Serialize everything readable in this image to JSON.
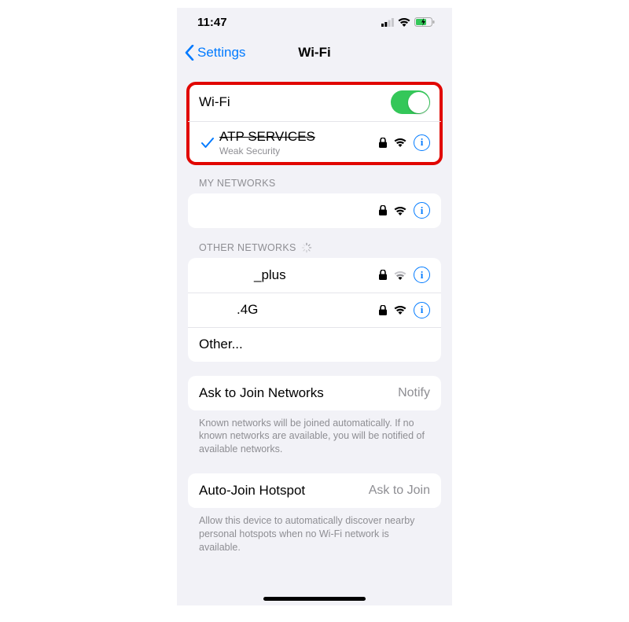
{
  "statusBar": {
    "time": "11:47"
  },
  "nav": {
    "backLabel": "Settings",
    "title": "Wi-Fi"
  },
  "wifi": {
    "toggleLabel": "Wi-Fi",
    "toggleOn": true,
    "connected": {
      "name": "ATP SERVICES",
      "subtitle": "Weak Security",
      "struck": true
    }
  },
  "myNetworks": {
    "header": "MY NETWORKS",
    "items": [
      {
        "name": ""
      }
    ]
  },
  "otherNetworks": {
    "header": "OTHER NETWORKS",
    "items": [
      {
        "name": "_plus"
      },
      {
        "name": ".4G"
      }
    ],
    "otherLabel": "Other..."
  },
  "askToJoin": {
    "title": "Ask to Join Networks",
    "value": "Notify",
    "footer": "Known networks will be joined automatically. If no known networks are available, you will be notified of available networks."
  },
  "autoJoin": {
    "title": "Auto-Join Hotspot",
    "value": "Ask to Join",
    "footer": "Allow this device to automatically discover nearby personal hotspots when no Wi-Fi network is available."
  }
}
